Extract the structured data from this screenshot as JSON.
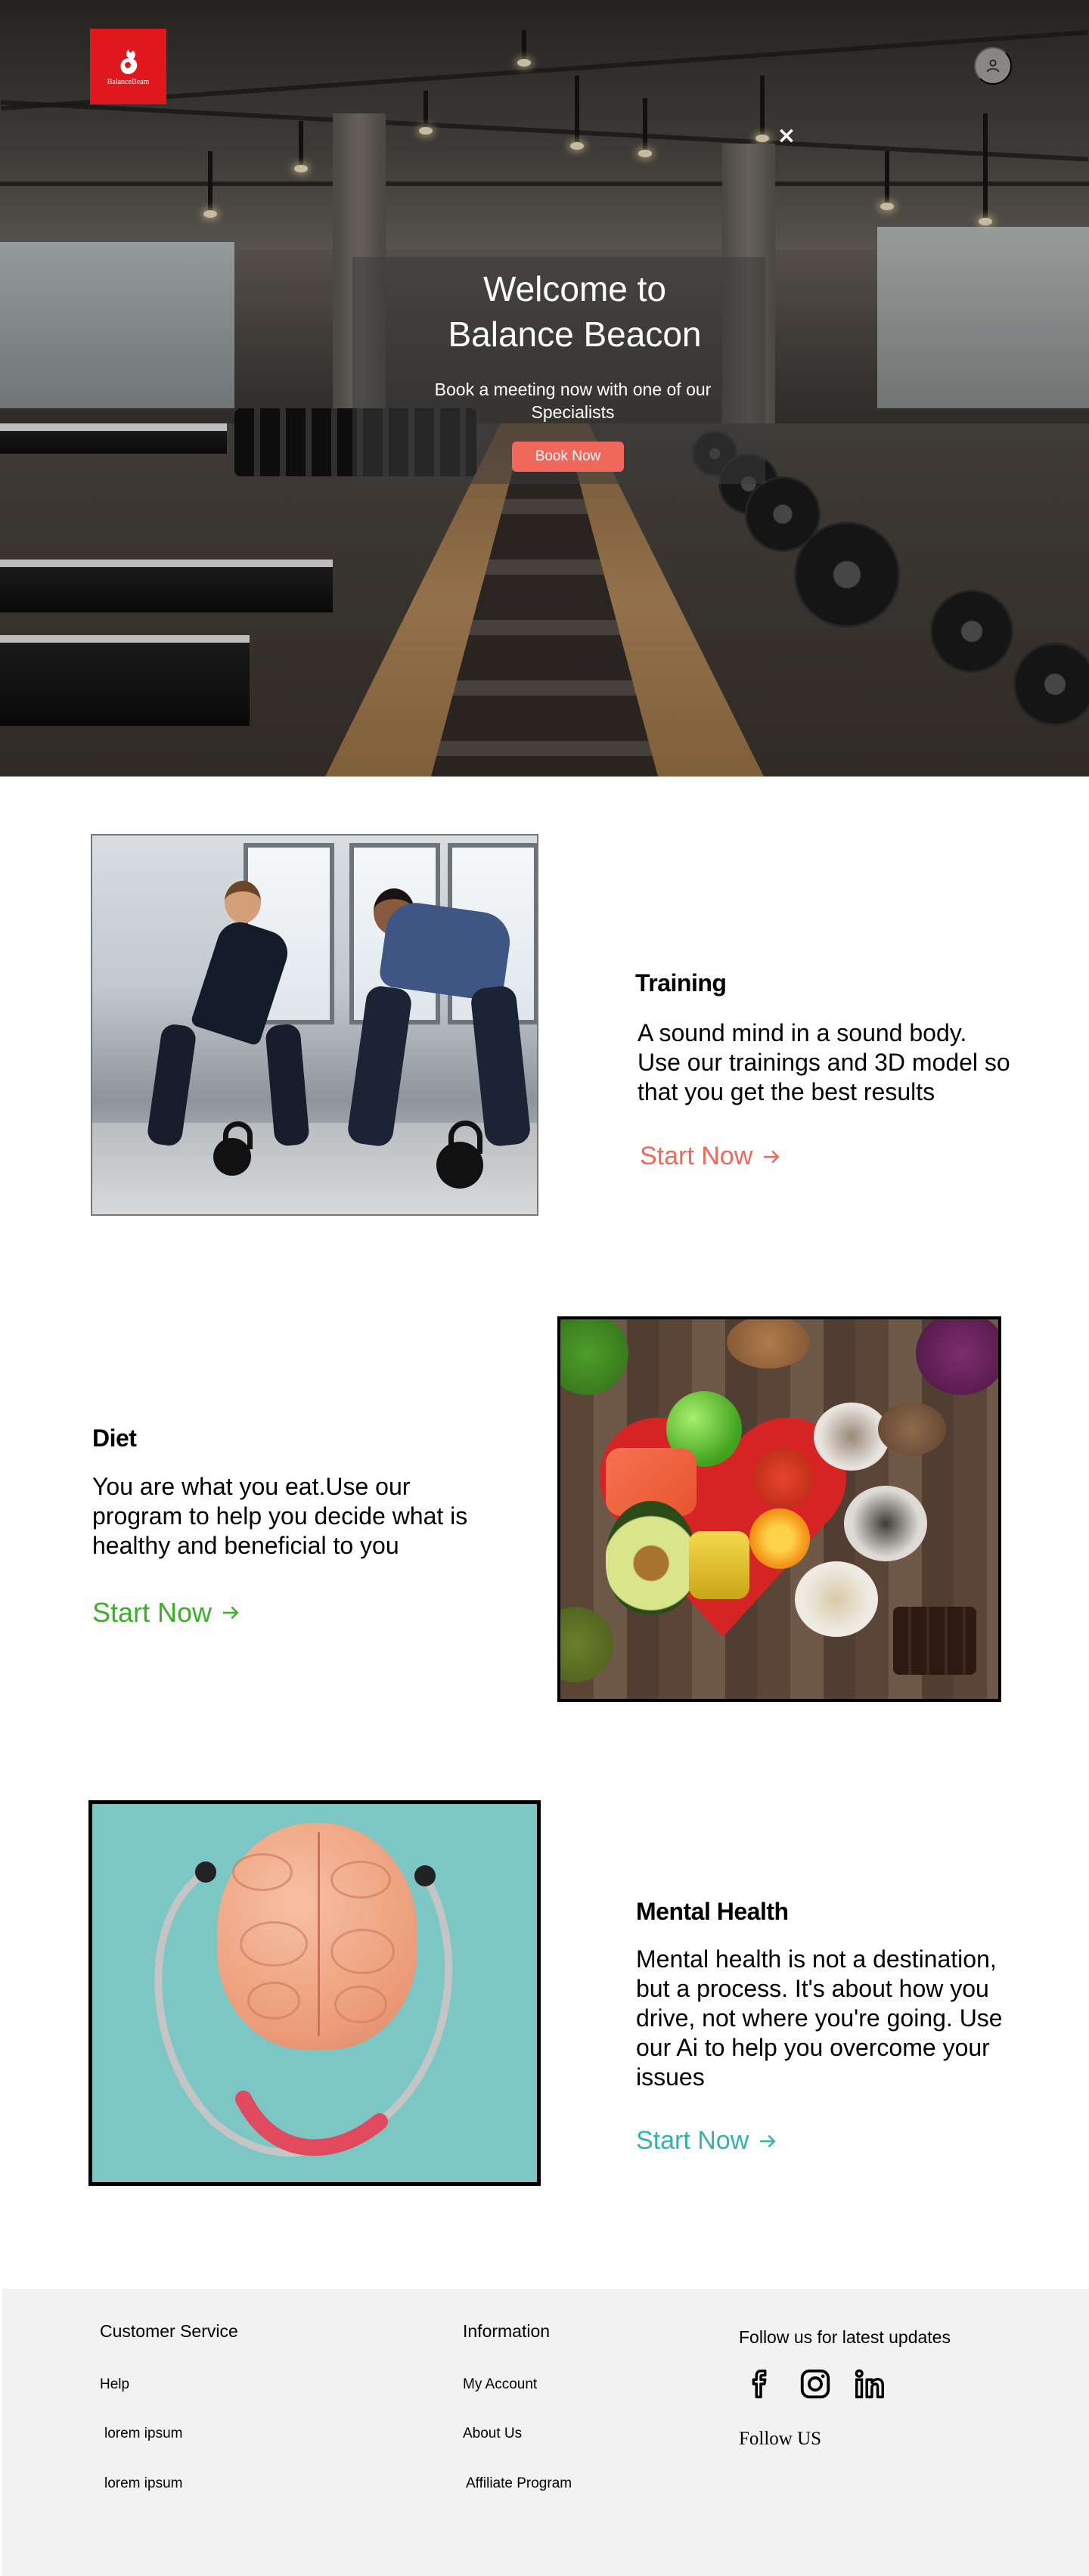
{
  "brand": {
    "logo_text": "BalanceBeam"
  },
  "hero": {
    "title_line1": "Welcome to",
    "title_line2": "Balance Beacon",
    "subtitle": "Book a meeting now with one of our Specialists",
    "book_button": "Book Now",
    "close_label": "×"
  },
  "sections": {
    "training": {
      "title": "Training",
      "description": "A sound mind in a sound body. Use our trainings and 3D model so that you get the best results",
      "cta": "Start Now",
      "cta_color": "#f0675b"
    },
    "diet": {
      "title": "Diet",
      "description": "You are what you eat.Use our program to help you decide what is healthy and beneficial to you",
      "cta": "Start Now",
      "cta_color": "#3bb02a"
    },
    "mental": {
      "title": "Mental Health",
      "description": "Mental health is not a destination, but a process. It's about how you drive, not where you're going. Use our Ai to help you overcome your issues",
      "cta": "Start Now",
      "cta_color": "#34b3ad"
    }
  },
  "footer": {
    "customer_service": {
      "heading": "Customer Service",
      "links": [
        "Help",
        "lorem ipsum",
        "lorem ipsum"
      ]
    },
    "information": {
      "heading": "Information",
      "links": [
        "My Account",
        "About Us",
        "Affiliate Program"
      ]
    },
    "social": {
      "heading": "Follow us for latest updates",
      "icons": [
        "facebook-icon",
        "instagram-icon",
        "linkedin-icon"
      ],
      "follow_label": "Follow US"
    }
  },
  "colors": {
    "brand_red": "#e0181e",
    "book_button": "#f0675b",
    "footer_bg": "#f2f2f2"
  }
}
